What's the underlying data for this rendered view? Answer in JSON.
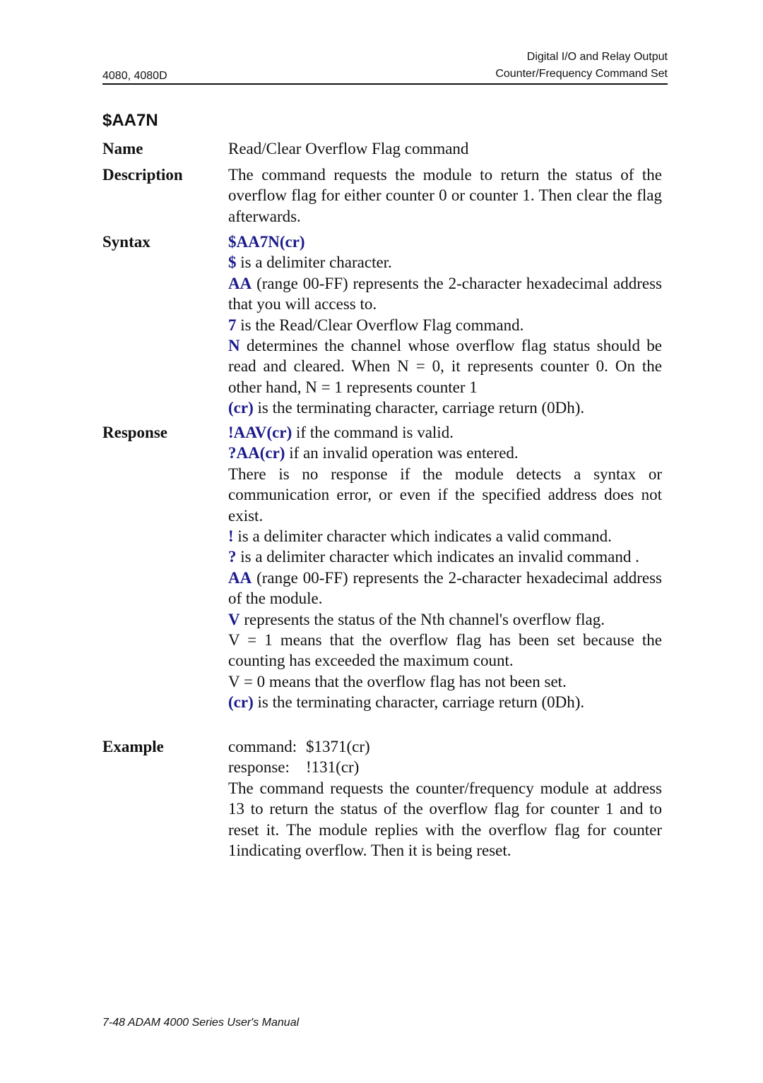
{
  "header": {
    "left": "4080, 4080D",
    "right_line1": "Digital I/O and Relay Output",
    "right_line2": "Counter/Frequency Command Set"
  },
  "title": "$AA7N",
  "sections": {
    "name": {
      "label": "Name",
      "text": "Read/Clear Overflow Flag command"
    },
    "description": {
      "label": "Description",
      "text": "The command requests the module to return the status of the overflow flag for either counter 0 or counter 1. Then clear the flag afterwards."
    },
    "syntax": {
      "label": "Syntax",
      "command": "$AA7N(cr)",
      "items": [
        {
          "key": "$",
          "text": " is a delimiter character."
        },
        {
          "key": "AA",
          "text": " (range 00-FF) represents the 2-character hexadecimal address that you will access to."
        },
        {
          "key": "7",
          "text": " is the Read/Clear Overflow Flag command."
        },
        {
          "key": "N",
          "text": " determines the channel whose overflow flag status should be read and cleared. When N = 0, it represents counter 0. On the other hand, N = 1 represents counter 1"
        },
        {
          "key": "(cr)",
          "text": " is the terminating character, carriage return (0Dh)."
        }
      ]
    },
    "response": {
      "label": "Response",
      "valid": {
        "key": "!AAV(cr)",
        "text": " if the command is valid."
      },
      "invalid": {
        "key": "?AA(cr)",
        "text": " if an invalid operation was entered."
      },
      "no_response": "There is no response if the module detects a syntax or communication error, or even if the specified address does not exist.",
      "items": [
        {
          "key": "!",
          "text": " is a delimiter character which indicates a valid command."
        },
        {
          "key": "?",
          "text": " is a delimiter character which indicates an invalid command ."
        },
        {
          "key": "AA",
          "text": " (range 00-FF) represents the 2-character hexadecimal address of the module."
        },
        {
          "key": "V",
          "text": " represents the status of the Nth channel's overflow flag."
        }
      ],
      "v1": "V = 1 means that the overflow flag has been set because the counting has exceeded the maximum count.",
      "v0": "V = 0 means that the overflow flag has not been set.",
      "cr": {
        "key": "(cr)",
        "text": " is the terminating character, carriage return (0Dh)."
      }
    },
    "example": {
      "label": "Example",
      "command_key": "command:",
      "command_val": "$1371(cr)",
      "response_key": "response:",
      "response_val": "!131(cr)",
      "text": "The command requests the counter/frequency module at address 13 to return the status of the overflow flag for counter 1 and to reset it. The module replies with the overflow flag for counter 1indicating overflow. Then it is being reset."
    }
  },
  "footer": "7-48 ADAM 4000 Series User's Manual",
  "colors": {
    "highlight": "#1a1a8c",
    "text": "#111111"
  }
}
